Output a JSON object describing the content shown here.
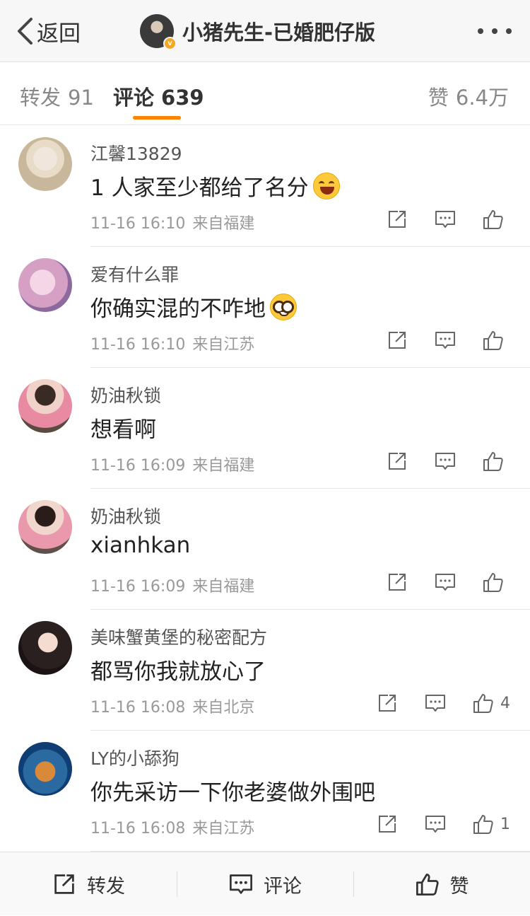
{
  "nav": {
    "back_label": "返回",
    "owner_name": "小猪先生-已婚肥仔版",
    "verified_badge": "v"
  },
  "tabs": {
    "repost": {
      "label": "转发",
      "count": "91"
    },
    "comments": {
      "label": "评论",
      "count": "639"
    },
    "likes": {
      "label": "赞",
      "count": "6.4万"
    },
    "accent_color": "#ff8200"
  },
  "comments": [
    {
      "user": "江馨13829",
      "text": "1  人家至少都给了名分",
      "emoji": "laugh-cry",
      "time": "11-16 16:10",
      "location": "来自福建",
      "likes": ""
    },
    {
      "user": "爱有什么罪",
      "text": "你确实混的不咋地",
      "emoji": "nerd-face",
      "time": "11-16 16:10",
      "location": "来自江苏",
      "likes": ""
    },
    {
      "user": "奶油秋锁",
      "text": "想看啊",
      "emoji": "",
      "time": "11-16 16:09",
      "location": "来自福建",
      "likes": ""
    },
    {
      "user": "奶油秋锁",
      "text": "xianhkan",
      "emoji": "",
      "time": "11-16 16:09",
      "location": "来自福建",
      "likes": ""
    },
    {
      "user": "美味蟹黄堡的秘密配方",
      "text": "都骂你我就放心了",
      "emoji": "",
      "time": "11-16 16:08",
      "location": "来自北京",
      "likes": "4"
    },
    {
      "user": "LY的小舔狗",
      "text": "你先采访一下你老婆做外围吧",
      "emoji": "",
      "time": "11-16 16:08",
      "location": "来自江苏",
      "likes": "1"
    }
  ],
  "bottom_bar": {
    "repost_label": "转发",
    "comment_label": "评论",
    "like_label": "赞"
  },
  "icons": [
    "chevron-left-icon",
    "more-dots-icon",
    "share-icon",
    "comment-icon",
    "thumbs-up-icon"
  ]
}
